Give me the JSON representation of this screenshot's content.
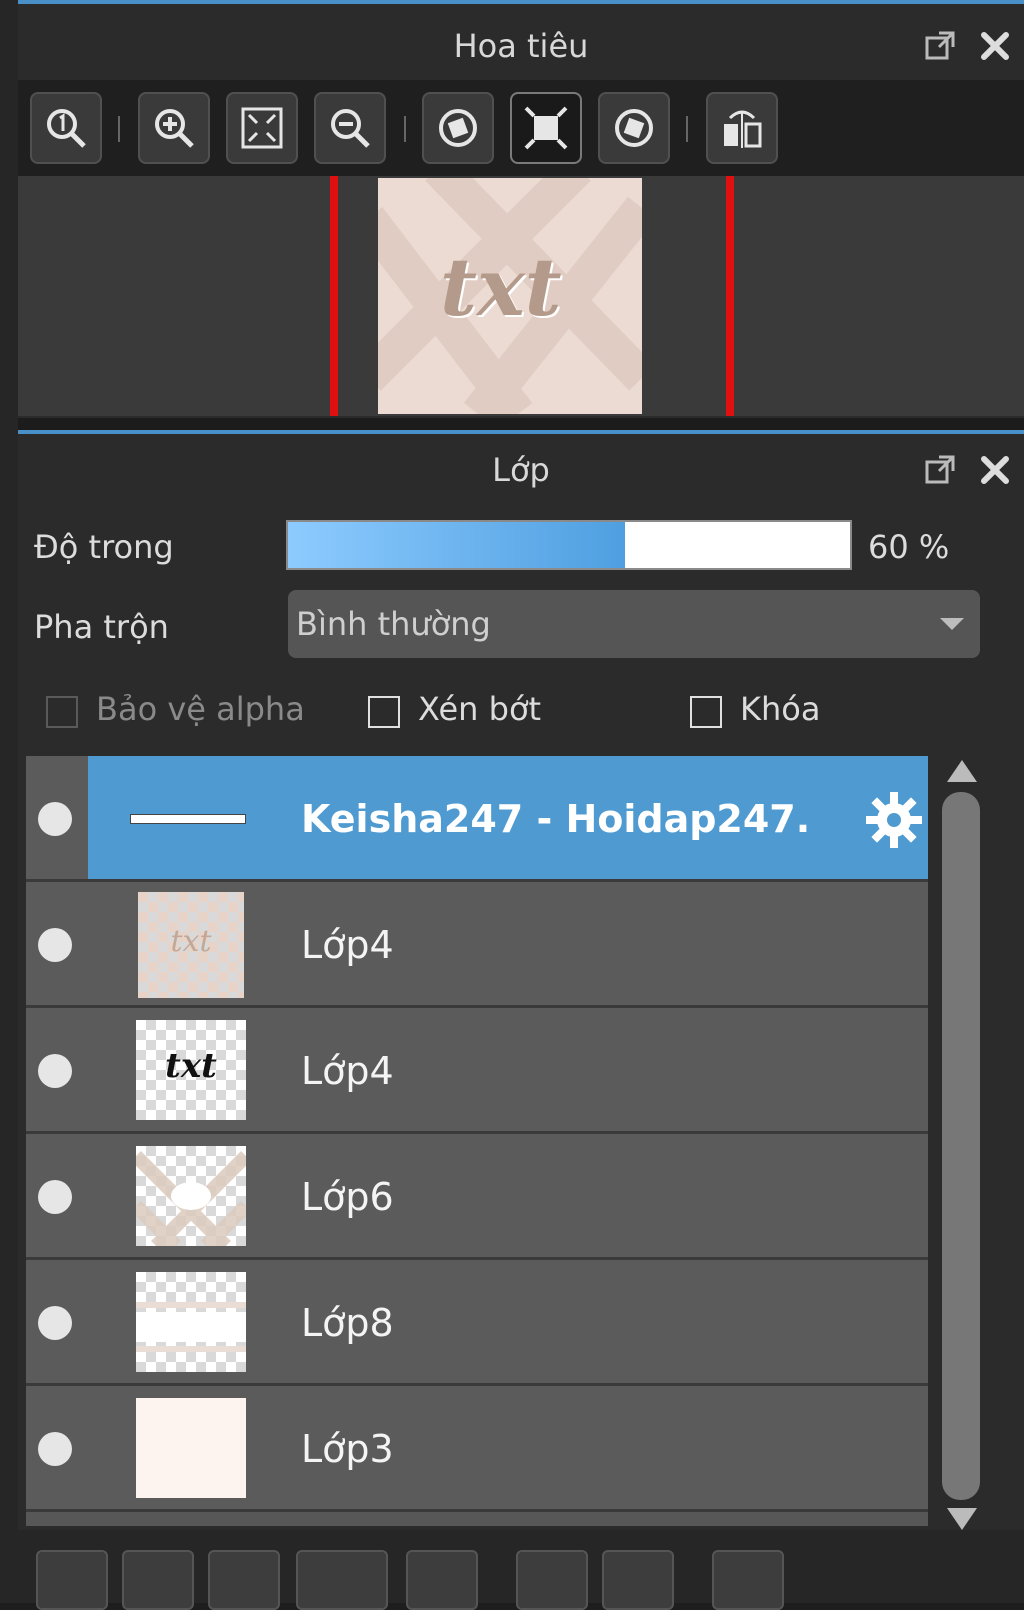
{
  "navigator": {
    "title": "Hoa tiêu",
    "toolbar_buttons": [
      "zoom-actual-icon",
      "zoom-in-icon",
      "fit-window-icon",
      "zoom-out-icon",
      "rotate-left-icon",
      "fit-canvas-icon",
      "rotate-right-icon",
      "flip-horizontal-icon"
    ]
  },
  "layers": {
    "title": "Lớp",
    "opacity_label": "Độ trong",
    "opacity_value": "60 %",
    "opacity_fraction": 0.6,
    "blend_label": "Pha trộn",
    "blend_value": "Bình thường",
    "checkboxes": {
      "protect_alpha": "Bảo vệ alpha",
      "clipping": "Xén bớt",
      "lock": "Khóa"
    },
    "items": [
      {
        "name": "Keisha247 - Hoidap247.",
        "selected": true
      },
      {
        "name": "Lớp4"
      },
      {
        "name": "Lớp4"
      },
      {
        "name": "Lớp6"
      },
      {
        "name": "Lớp8"
      },
      {
        "name": "Lớp3"
      }
    ],
    "thumbnail_texts": {
      "preview_txt": "txt",
      "layer4a_txt": "txt",
      "layer4b_txt": "txt"
    }
  },
  "colors": {
    "accent": "#4f9bd1",
    "redline": "#e01010"
  }
}
